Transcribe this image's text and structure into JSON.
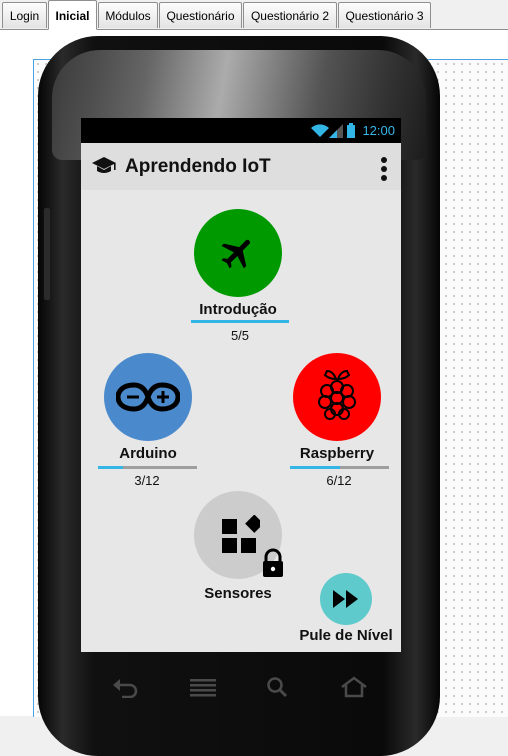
{
  "tabs": [
    {
      "label": "Login",
      "active": false
    },
    {
      "label": "Inicial",
      "active": true
    },
    {
      "label": "Módulos",
      "active": false
    },
    {
      "label": "Questionário",
      "active": false
    },
    {
      "label": "Questionário 2",
      "active": false
    },
    {
      "label": "Questionário 3",
      "active": false
    }
  ],
  "status_bar": {
    "time": "12:00"
  },
  "app_bar": {
    "title": "Aprendendo IoT",
    "icon": "graduation-cap-icon",
    "menu_icon": "more-vert-icon"
  },
  "modules": {
    "intro": {
      "label": "Introdução",
      "progress_text": "5/5",
      "progress": 1.0,
      "color": "#009900",
      "icon": "airplane-icon"
    },
    "arduino": {
      "label": "Arduino",
      "progress_text": "3/12",
      "progress": 0.25,
      "color": "#4a89cc",
      "icon": "arduino-icon"
    },
    "raspberry": {
      "label": "Raspberry",
      "progress_text": "6/12",
      "progress": 0.5,
      "color": "#ff0000",
      "icon": "raspberry-icon"
    },
    "sensores": {
      "label": "Sensores",
      "locked": true,
      "color": "#cccccc",
      "icon": "widgets-icon"
    }
  },
  "skip_level": {
    "label": "Pule de Nível",
    "color": "#5fcacc",
    "icon": "fast-forward-icon"
  },
  "colors": {
    "accent": "#33b5e5",
    "track": "#9e9e9e"
  }
}
